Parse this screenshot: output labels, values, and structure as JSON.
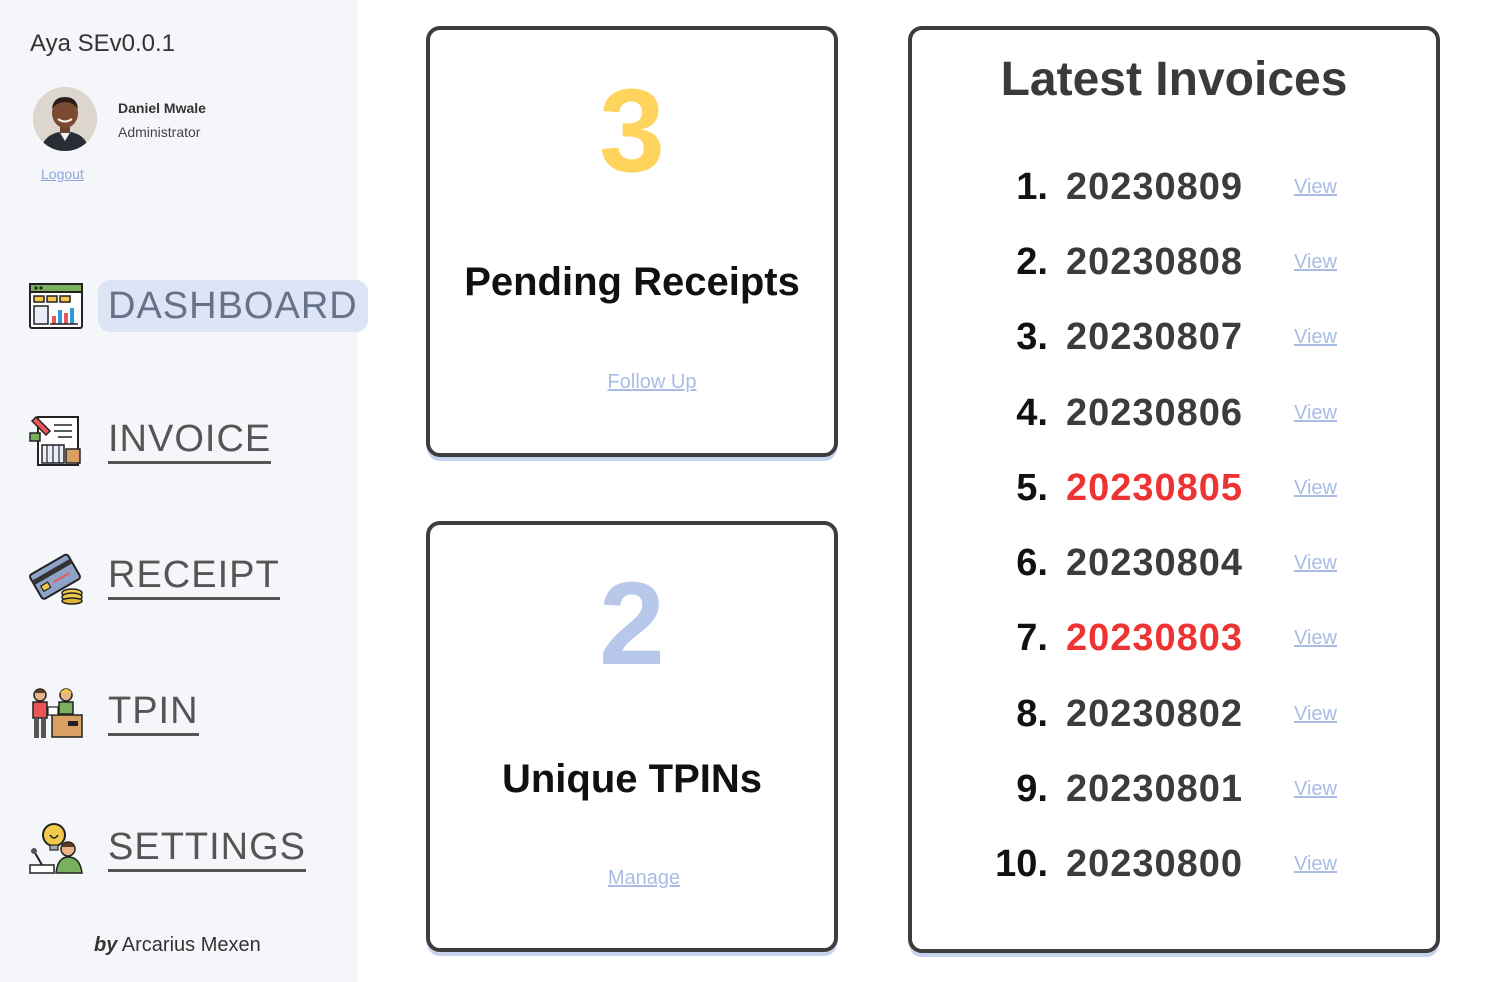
{
  "app": {
    "title": "Aya SEv0.0.1"
  },
  "user": {
    "name": "Daniel Mwale",
    "role": "Administrator",
    "logout_label": "Logout"
  },
  "nav": {
    "items": [
      {
        "label": "DASHBOARD",
        "icon": "dashboard-icon",
        "active": true
      },
      {
        "label": "INVOICE",
        "icon": "invoice-icon",
        "active": false
      },
      {
        "label": "RECEIPT",
        "icon": "receipt-icon",
        "active": false
      },
      {
        "label": "TPIN",
        "icon": "tpin-icon",
        "active": false
      },
      {
        "label": "SETTINGS",
        "icon": "settings-icon",
        "active": false
      }
    ]
  },
  "credit": {
    "by": "by",
    "name": "Arcarius Mexen"
  },
  "cards": {
    "pending": {
      "count": "3",
      "title": "Pending Receipts",
      "link": "Follow Up",
      "color": "#ffd45c"
    },
    "tpins": {
      "count": "2",
      "title": "Unique TPINs",
      "link": "Manage",
      "color": "#b7c8ea"
    }
  },
  "invoices": {
    "title": "Latest Invoices",
    "view_label": "View",
    "items": [
      {
        "index": "1.",
        "number": "20230809",
        "highlight": false
      },
      {
        "index": "2.",
        "number": "20230808",
        "highlight": false
      },
      {
        "index": "3.",
        "number": "20230807",
        "highlight": false
      },
      {
        "index": "4.",
        "number": "20230806",
        "highlight": false
      },
      {
        "index": "5.",
        "number": "20230805",
        "highlight": true
      },
      {
        "index": "6.",
        "number": "20230804",
        "highlight": false
      },
      {
        "index": "7.",
        "number": "20230803",
        "highlight": true
      },
      {
        "index": "8.",
        "number": "20230802",
        "highlight": false
      },
      {
        "index": "9.",
        "number": "20230801",
        "highlight": false
      },
      {
        "index": "10.",
        "number": "20230800",
        "highlight": false
      }
    ]
  },
  "colors": {
    "accent": "#dde4f5",
    "link": "#a8bce6",
    "alert": "#ee3333"
  }
}
